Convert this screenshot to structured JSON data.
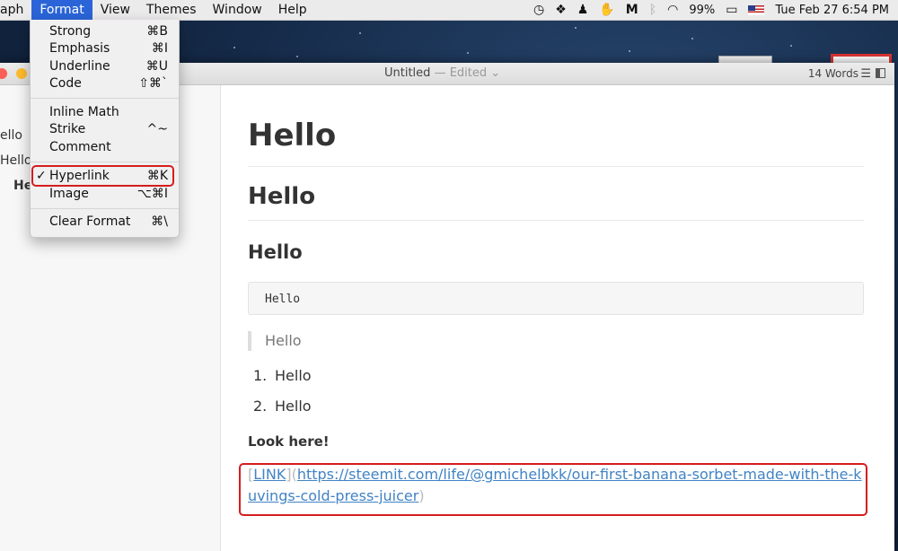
{
  "menubar": {
    "items": [
      "aph",
      "Format",
      "View",
      "Themes",
      "Window",
      "Help"
    ],
    "battery": "99%",
    "datetime": "Tue Feb 27  6:54 PM"
  },
  "window": {
    "title": "Untitled",
    "edited": " — Edited ⌄",
    "word_count": "14 Words"
  },
  "sidebar": {
    "items": [
      "ello",
      "Hello",
      "He"
    ]
  },
  "dropdown": {
    "groups": [
      [
        {
          "label": "Strong",
          "shortcut": "⌘B"
        },
        {
          "label": "Emphasis",
          "shortcut": "⌘I"
        },
        {
          "label": "Underline",
          "shortcut": "⌘U"
        },
        {
          "label": "Code",
          "shortcut": "⇧⌘`"
        }
      ],
      [
        {
          "label": "Inline Math",
          "shortcut": ""
        },
        {
          "label": "Strike",
          "shortcut": "^~"
        },
        {
          "label": "Comment",
          "shortcut": ""
        }
      ],
      [
        {
          "label": "Hyperlink",
          "shortcut": "⌘K",
          "checked": true
        },
        {
          "label": "Image",
          "shortcut": "⌥⌘I"
        }
      ],
      [
        {
          "label": "Clear Format",
          "shortcut": "⌘\\"
        }
      ]
    ],
    "check_glyph": "✓"
  },
  "document": {
    "h1": "Hello",
    "h2": "Hello",
    "h3": "Hello",
    "code": "Hello",
    "quote": "Hello",
    "list": [
      "Hello",
      "Hello"
    ],
    "list_numbers": [
      "1.",
      "2."
    ],
    "bold_text": "Look here!",
    "link": {
      "open_bracket": "[",
      "text": "LINK",
      "middle": "](",
      "url": "https://steemit.com/life/@gmichelbkk/our-first-banana-sorbet-made-with-the-kuvings-cold-press-juicer",
      "close_paren": ")"
    }
  },
  "colors": {
    "menu_highlight": "#2a64d8",
    "annotation_red": "#d51d1d",
    "link_blue": "#4183c4"
  }
}
